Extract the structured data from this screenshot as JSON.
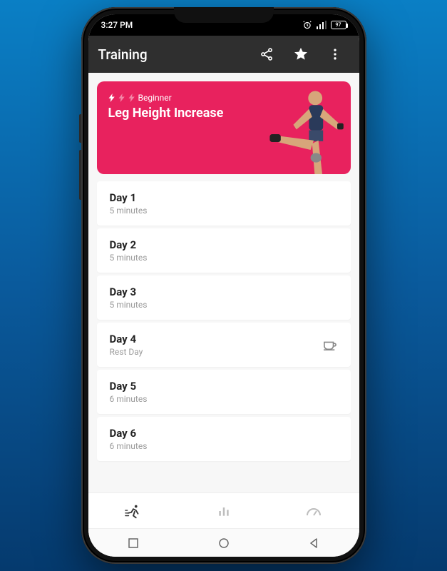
{
  "status": {
    "time": "3:27 PM",
    "battery_label": "97"
  },
  "appbar": {
    "title": "Training"
  },
  "hero": {
    "level_label": "Beginner",
    "title": "Leg Height Increase",
    "difficulty_filled": 1,
    "difficulty_total": 3
  },
  "days": [
    {
      "title": "Day 1",
      "subtitle": "5 minutes",
      "rest": false
    },
    {
      "title": "Day 2",
      "subtitle": "5 minutes",
      "rest": false
    },
    {
      "title": "Day 3",
      "subtitle": "5 minutes",
      "rest": false
    },
    {
      "title": "Day 4",
      "subtitle": "Rest Day",
      "rest": true
    },
    {
      "title": "Day 5",
      "subtitle": "6 minutes",
      "rest": false
    },
    {
      "title": "Day 6",
      "subtitle": "6 minutes",
      "rest": false
    }
  ],
  "bottom_nav": {
    "active_index": 0,
    "tabs": [
      "training",
      "stats",
      "speed"
    ]
  }
}
